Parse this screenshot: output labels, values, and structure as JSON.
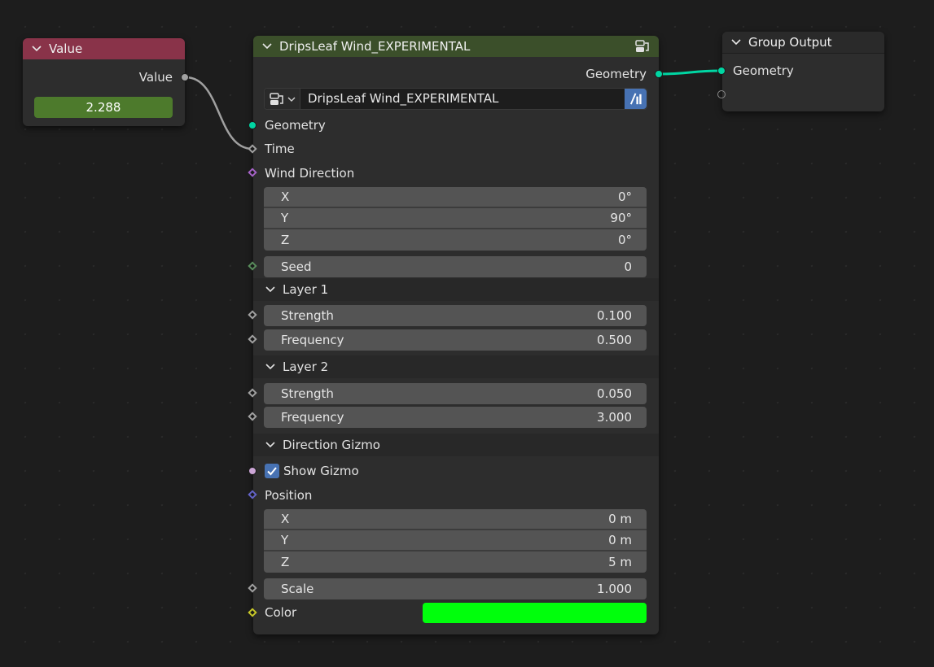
{
  "value_node": {
    "title": "Value",
    "output_label": "Value",
    "value": "2.288",
    "header_color": "#893349"
  },
  "group_node": {
    "title": "DripsLeaf Wind_EXPERIMENTAL",
    "header_color": "#3b4f2a",
    "output_label": "Geometry",
    "selector_name": "DripsLeaf Wind_EXPERIMENTAL",
    "inputs": {
      "geometry": "Geometry",
      "time": "Time",
      "wind_direction": "Wind Direction",
      "wind_x_label": "X",
      "wind_x_value": "0°",
      "wind_y_label": "Y",
      "wind_y_value": "90°",
      "wind_z_label": "Z",
      "wind_z_value": "0°",
      "seed_label": "Seed",
      "seed_value": "0"
    },
    "panels": {
      "layer1": {
        "title": "Layer 1",
        "strength_label": "Strength",
        "strength_value": "0.100",
        "frequency_label": "Frequency",
        "frequency_value": "0.500"
      },
      "layer2": {
        "title": "Layer 2",
        "strength_label": "Strength",
        "strength_value": "0.050",
        "frequency_label": "Frequency",
        "frequency_value": "3.000"
      },
      "gizmo": {
        "title": "Direction Gizmo",
        "show_gizmo_label": "Show Gizmo",
        "show_gizmo_checked": true,
        "position_label": "Position",
        "pos_x_label": "X",
        "pos_x_value": "0 m",
        "pos_y_label": "Y",
        "pos_y_value": "0 m",
        "pos_z_label": "Z",
        "pos_z_value": "5 m",
        "scale_label": "Scale",
        "scale_value": "1.000",
        "color_label": "Color",
        "color_value": "#00ff0c"
      }
    }
  },
  "output_node": {
    "title": "Group Output",
    "input_label": "Geometry"
  },
  "colors": {
    "geometry_socket": "#00d6a3",
    "float_socket": "#a1a1a1",
    "vector_socket": "#6363c7",
    "rotation_socket": "#a663c7",
    "int_socket": "#598c5c",
    "bool_socket": "#cca6d6",
    "color_socket": "#c7c729",
    "value_field": "#4d7a2c",
    "checkbox": "#4772b3"
  },
  "icons": [
    "chevron-down-icon",
    "node-tree-icon",
    "fake-user-icon",
    "checkmark-icon"
  ]
}
